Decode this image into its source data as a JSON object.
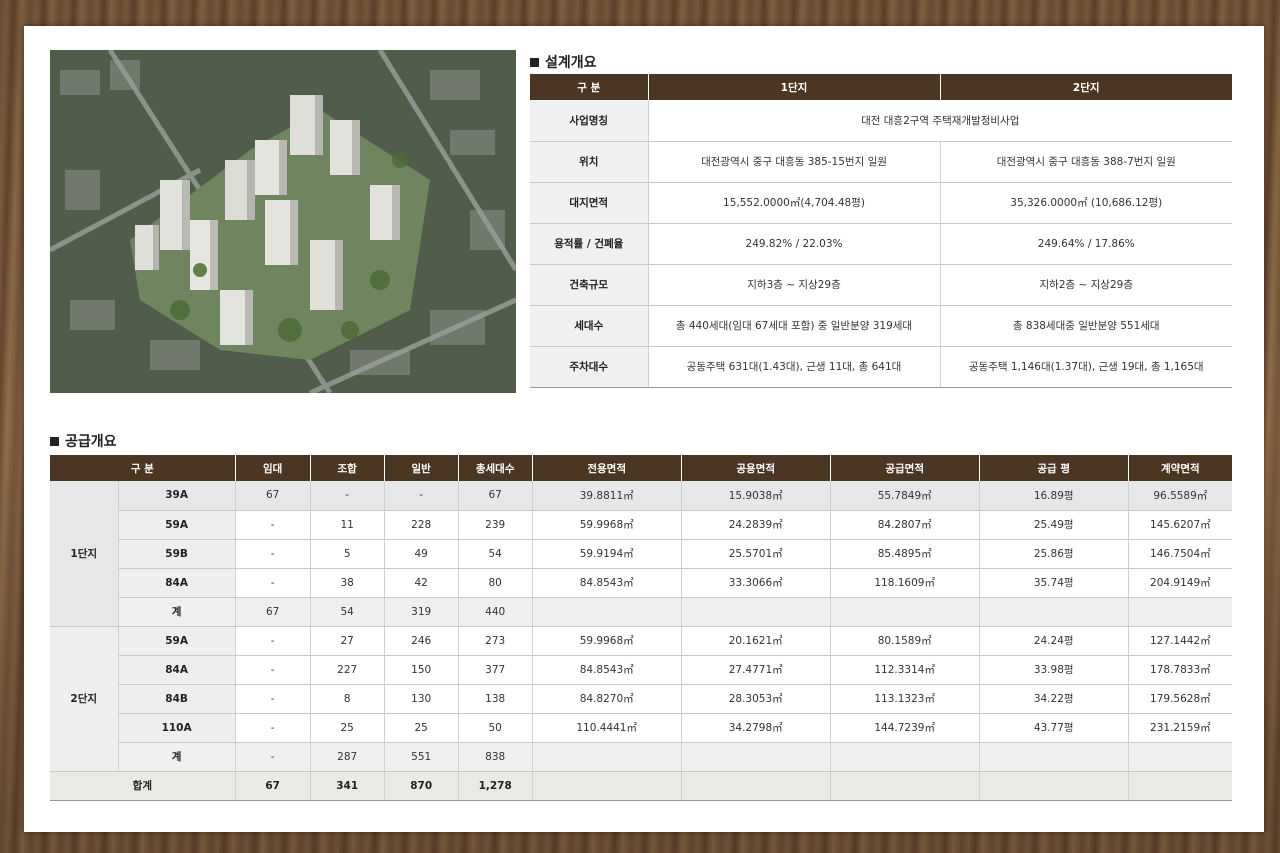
{
  "design": {
    "section_title": "설계개요",
    "headers": [
      "구 분",
      "1단지",
      "2단지"
    ],
    "rows": [
      {
        "label": "사업명칭",
        "merged": "대전 대흥2구역 주택재개발정비사업"
      },
      {
        "label": "위치",
        "c1": "대전광역시 중구 대흥동 385-15번지 일원",
        "c2": "대전광역시 중구 대흥동 388-7번지 일원"
      },
      {
        "label": "대지면적",
        "c1": "15,552.0000㎡(4,704.48평)",
        "c2": "35,326.0000㎡ (10,686.12평)"
      },
      {
        "label": "용적률 / 건폐율",
        "c1": "249.82% / 22.03%",
        "c2": "249.64% / 17.86%"
      },
      {
        "label": "건축규모",
        "c1": "지하3층 ~ 지상29층",
        "c2": "지하2층 ~ 지상29층"
      },
      {
        "label": "세대수",
        "c1": "총 440세대(임대 67세대 포함) 중 일반분양 319세대",
        "c2": "총 838세대중 일반분양 551세대"
      },
      {
        "label": "주차대수",
        "c1": "공동주택 631대(1.43대), 근생 11대, 총 641대",
        "c2": "공동주택 1,146대(1.37대), 근생 19대, 총 1,165대"
      }
    ]
  },
  "supply": {
    "section_title": "공급개요",
    "headers": [
      "구 분",
      "임대",
      "조합",
      "일반",
      "총세대수",
      "전용면적",
      "공용면적",
      "공급면적",
      "공급 평",
      "계약면적"
    ],
    "groups": [
      {
        "name": "1단지",
        "rows": [
          [
            "39A",
            "67",
            "-",
            "-",
            "67",
            "39.8811㎡",
            "15.9038㎡",
            "55.7849㎡",
            "16.89평",
            "96.5589㎡"
          ],
          [
            "59A",
            "-",
            "11",
            "228",
            "239",
            "59.9968㎡",
            "24.2839㎡",
            "84.2807㎡",
            "25.49평",
            "145.6207㎡"
          ],
          [
            "59B",
            "-",
            "5",
            "49",
            "54",
            "59.9194㎡",
            "25.5701㎡",
            "85.4895㎡",
            "25.86평",
            "146.7504㎡"
          ],
          [
            "84A",
            "-",
            "38",
            "42",
            "80",
            "84.8543㎡",
            "33.3066㎡",
            "118.1609㎡",
            "35.74평",
            "204.9149㎡"
          ]
        ],
        "sum": [
          "계",
          "67",
          "54",
          "319",
          "440"
        ]
      },
      {
        "name": "2단지",
        "rows": [
          [
            "59A",
            "-",
            "27",
            "246",
            "273",
            "59.9968㎡",
            "20.1621㎡",
            "80.1589㎡",
            "24.24평",
            "127.1442㎡"
          ],
          [
            "84A",
            "-",
            "227",
            "150",
            "377",
            "84.8543㎡",
            "27.4771㎡",
            "112.3314㎡",
            "33.98평",
            "178.7833㎡"
          ],
          [
            "84B",
            "-",
            "8",
            "130",
            "138",
            "84.8270㎡",
            "28.3053㎡",
            "113.1323㎡",
            "34.22평",
            "179.5628㎡"
          ],
          [
            "110A",
            "-",
            "25",
            "25",
            "50",
            "110.4441㎡",
            "34.2798㎡",
            "144.7239㎡",
            "43.77평",
            "231.2159㎡"
          ]
        ],
        "sum": [
          "계",
          "-",
          "287",
          "551",
          "838"
        ]
      }
    ],
    "total": [
      "합계",
      "67",
      "341",
      "870",
      "1,278"
    ]
  }
}
